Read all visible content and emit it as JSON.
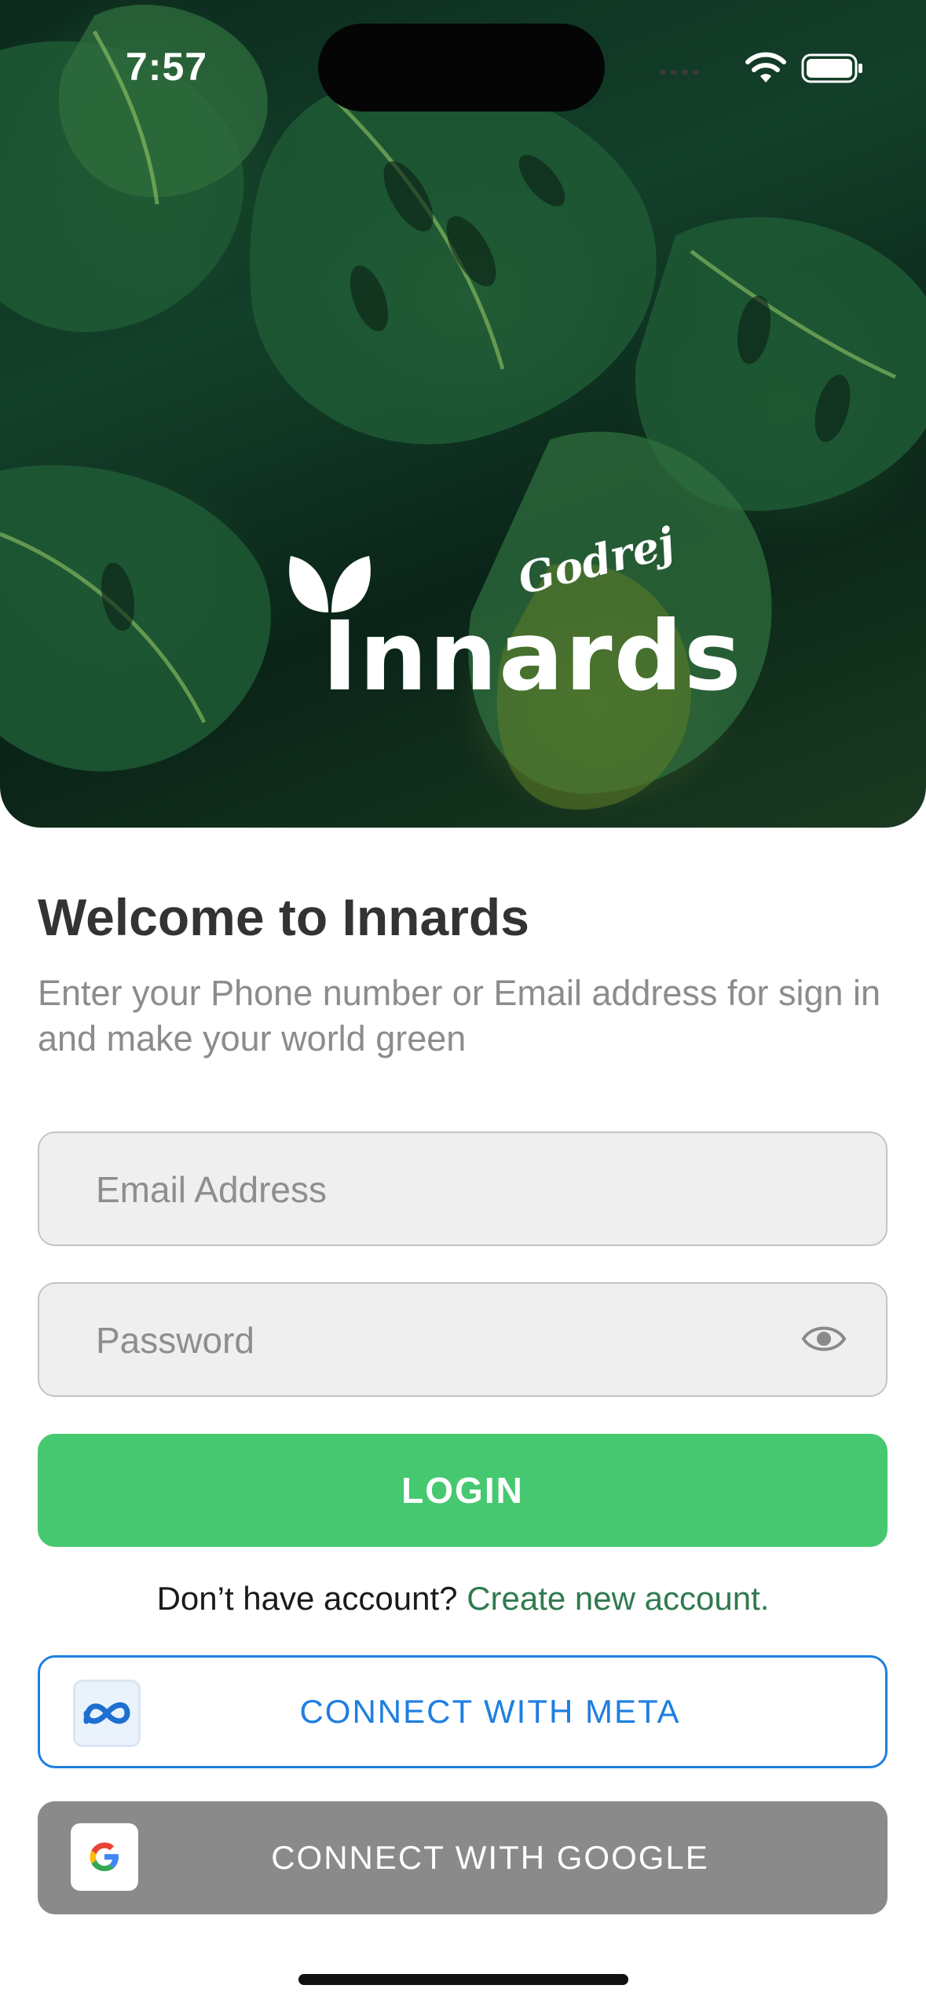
{
  "status_bar": {
    "time": "7:57"
  },
  "hero": {
    "logo_text": "Innards",
    "logo_brand": "Godrej"
  },
  "welcome": {
    "title": "Welcome to Innards",
    "subtitle": "Enter your Phone number or Email address for sign in and make your world green"
  },
  "form": {
    "email_placeholder": "Email Address",
    "password_placeholder": "Password",
    "login_label": "LOGIN"
  },
  "signup": {
    "prompt": "Don’t have account?",
    "link": "Create new account."
  },
  "social": {
    "meta_label": "CONNECT WITH  META",
    "google_label": "CONNECT WITH  GOOGLE"
  },
  "colors": {
    "primary_green": "#46c870",
    "link_green": "#2f7a4f",
    "meta_blue": "#1e7fe0",
    "google_gray": "#8a8a8a"
  },
  "icons": [
    "wifi-icon",
    "battery-icon",
    "eye-icon",
    "meta-logo-icon",
    "google-logo-icon"
  ]
}
